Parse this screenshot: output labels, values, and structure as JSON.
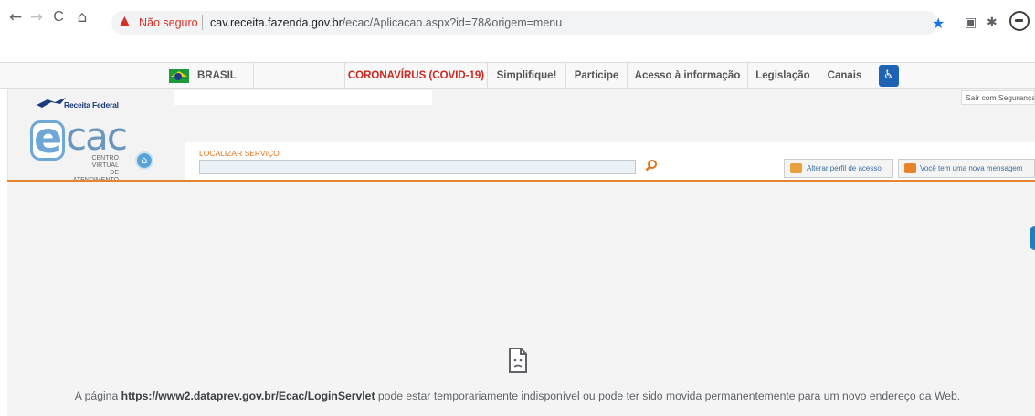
{
  "browser": {
    "nav": {
      "back": "←",
      "forward": "→",
      "reload": "C",
      "home": "⌂"
    },
    "security_label": "Não seguro",
    "url_host": "cav.receita.fazenda.gov.br",
    "url_path": "/ecac/Aplicacao.aspx?id=78&origem=menu",
    "bookmark_icon": "★"
  },
  "govbar": {
    "brasil": "BRASIL",
    "items": [
      "CORONAVÍRUS (COVID-19)",
      "Simplifique!",
      "Participe",
      "Acesso à informação",
      "Legislação",
      "Canais"
    ]
  },
  "header": {
    "rf_label": "Receita Federal",
    "logo_e": "e",
    "logo_cac": "cac",
    "logo_sub1": "CENTRO VIRTUAL",
    "logo_sub2": "DE ATENDIMENTO",
    "sair": "Sair com Segurança",
    "search_label": "LOCALIZAR SERVIÇO",
    "search_value": "",
    "perfil_btn": "Alterar perfil de acesso",
    "msg_btn": "Você tem uma nova mensagem"
  },
  "error": {
    "prefix": "A página ",
    "url": "https://www2.dataprev.gov.br/Ecac/LoginServlet",
    "suffix": " pode estar temporariamente indisponível ou pode ter sido movida permanentemente para um novo endereço da Web."
  },
  "colors": {
    "accent": "#e8842a",
    "link": "#3a6ea5",
    "covid": "#d0261d",
    "insecure": "#d93025"
  }
}
